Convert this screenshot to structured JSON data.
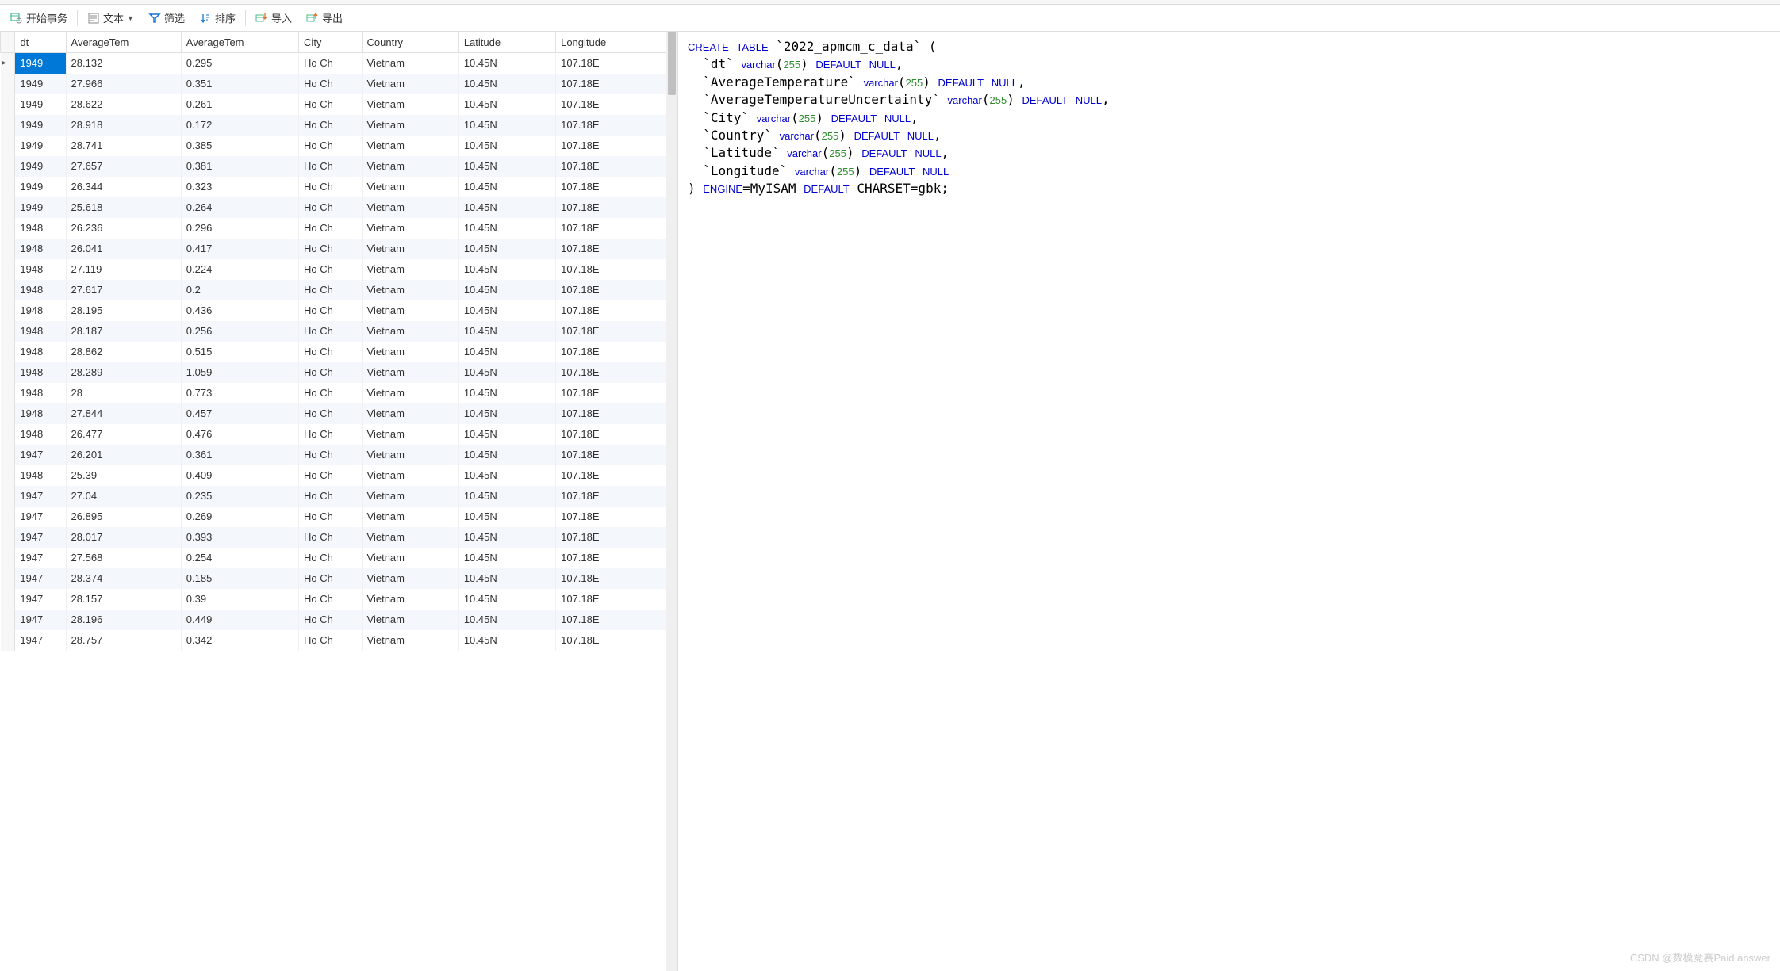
{
  "toolbar": {
    "begin_trans": "开始事务",
    "text": "文本",
    "filter": "筛选",
    "sort": "排序",
    "import": "导入",
    "export": "导出"
  },
  "table": {
    "columns": [
      "dt",
      "AverageTem",
      "AverageTem",
      "City",
      "Country",
      "Latitude",
      "Longitude"
    ],
    "rows": [
      [
        "1949",
        "28.132",
        "0.295",
        "Ho Ch",
        "Vietnam",
        "10.45N",
        "107.18E"
      ],
      [
        "1949",
        "27.966",
        "0.351",
        "Ho Ch",
        "Vietnam",
        "10.45N",
        "107.18E"
      ],
      [
        "1949",
        "28.622",
        "0.261",
        "Ho Ch",
        "Vietnam",
        "10.45N",
        "107.18E"
      ],
      [
        "1949",
        "28.918",
        "0.172",
        "Ho Ch",
        "Vietnam",
        "10.45N",
        "107.18E"
      ],
      [
        "1949",
        "28.741",
        "0.385",
        "Ho Ch",
        "Vietnam",
        "10.45N",
        "107.18E"
      ],
      [
        "1949",
        "27.657",
        "0.381",
        "Ho Ch",
        "Vietnam",
        "10.45N",
        "107.18E"
      ],
      [
        "1949",
        "26.344",
        "0.323",
        "Ho Ch",
        "Vietnam",
        "10.45N",
        "107.18E"
      ],
      [
        "1949",
        "25.618",
        "0.264",
        "Ho Ch",
        "Vietnam",
        "10.45N",
        "107.18E"
      ],
      [
        "1948",
        "26.236",
        "0.296",
        "Ho Ch",
        "Vietnam",
        "10.45N",
        "107.18E"
      ],
      [
        "1948",
        "26.041",
        "0.417",
        "Ho Ch",
        "Vietnam",
        "10.45N",
        "107.18E"
      ],
      [
        "1948",
        "27.119",
        "0.224",
        "Ho Ch",
        "Vietnam",
        "10.45N",
        "107.18E"
      ],
      [
        "1948",
        "27.617",
        "0.2",
        "Ho Ch",
        "Vietnam",
        "10.45N",
        "107.18E"
      ],
      [
        "1948",
        "28.195",
        "0.436",
        "Ho Ch",
        "Vietnam",
        "10.45N",
        "107.18E"
      ],
      [
        "1948",
        "28.187",
        "0.256",
        "Ho Ch",
        "Vietnam",
        "10.45N",
        "107.18E"
      ],
      [
        "1948",
        "28.862",
        "0.515",
        "Ho Ch",
        "Vietnam",
        "10.45N",
        "107.18E"
      ],
      [
        "1948",
        "28.289",
        "1.059",
        "Ho Ch",
        "Vietnam",
        "10.45N",
        "107.18E"
      ],
      [
        "1948",
        "28",
        "0.773",
        "Ho Ch",
        "Vietnam",
        "10.45N",
        "107.18E"
      ],
      [
        "1948",
        "27.844",
        "0.457",
        "Ho Ch",
        "Vietnam",
        "10.45N",
        "107.18E"
      ],
      [
        "1948",
        "26.477",
        "0.476",
        "Ho Ch",
        "Vietnam",
        "10.45N",
        "107.18E"
      ],
      [
        "1947",
        "26.201",
        "0.361",
        "Ho Ch",
        "Vietnam",
        "10.45N",
        "107.18E"
      ],
      [
        "1948",
        "25.39",
        "0.409",
        "Ho Ch",
        "Vietnam",
        "10.45N",
        "107.18E"
      ],
      [
        "1947",
        "27.04",
        "0.235",
        "Ho Ch",
        "Vietnam",
        "10.45N",
        "107.18E"
      ],
      [
        "1947",
        "26.895",
        "0.269",
        "Ho Ch",
        "Vietnam",
        "10.45N",
        "107.18E"
      ],
      [
        "1947",
        "28.017",
        "0.393",
        "Ho Ch",
        "Vietnam",
        "10.45N",
        "107.18E"
      ],
      [
        "1947",
        "27.568",
        "0.254",
        "Ho Ch",
        "Vietnam",
        "10.45N",
        "107.18E"
      ],
      [
        "1947",
        "28.374",
        "0.185",
        "Ho Ch",
        "Vietnam",
        "10.45N",
        "107.18E"
      ],
      [
        "1947",
        "28.157",
        "0.39",
        "Ho Ch",
        "Vietnam",
        "10.45N",
        "107.18E"
      ],
      [
        "1947",
        "28.196",
        "0.449",
        "Ho Ch",
        "Vietnam",
        "10.45N",
        "107.18E"
      ],
      [
        "1947",
        "28.757",
        "0.342",
        "Ho Ch",
        "Vietnam",
        "10.45N",
        "107.18E"
      ]
    ]
  },
  "sql": {
    "table_name": "2022_apmcm_c_data",
    "cols": [
      {
        "name": "dt",
        "type": "varchar",
        "len": "255"
      },
      {
        "name": "AverageTemperature",
        "type": "varchar",
        "len": "255"
      },
      {
        "name": "AverageTemperatureUncertainty",
        "type": "varchar",
        "len": "255"
      },
      {
        "name": "City",
        "type": "varchar",
        "len": "255"
      },
      {
        "name": "Country",
        "type": "varchar",
        "len": "255"
      },
      {
        "name": "Latitude",
        "type": "varchar",
        "len": "255"
      },
      {
        "name": "Longitude",
        "type": "varchar",
        "len": "255"
      }
    ],
    "engine": "MyISAM",
    "charset": "gbk"
  },
  "watermark": "CSDN @数模竞赛Paid answer"
}
